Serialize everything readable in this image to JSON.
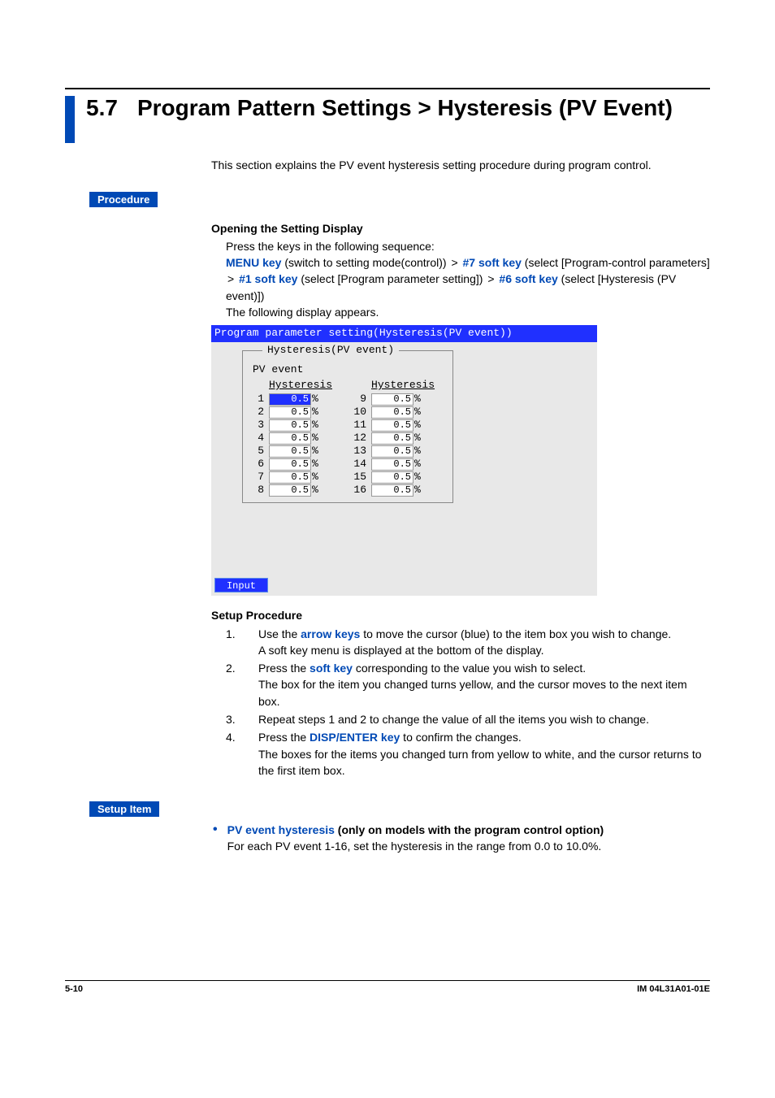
{
  "section": {
    "number": "5.7",
    "title": "Program Pattern Settings > Hysteresis (PV Event)"
  },
  "intro": "This section explains the PV event hysteresis setting procedure during program control.",
  "tags": {
    "procedure": "Procedure",
    "setup_item": "Setup Item"
  },
  "opening": {
    "head": "Opening the Setting Display",
    "press": "Press the keys in the following sequence:",
    "seq": {
      "menu_key": "MENU key",
      "menu_key_after": " (switch to setting mode(control)) ",
      "k7": "#7 soft key",
      "k7_after": " (select [Program-control parameters] ",
      "k1": "#1 soft key",
      "k1_after": " (select [Program parameter setting]) ",
      "k6": "#6 soft key",
      "k6_after": " (select [Hysteresis (PV event)])"
    },
    "appears": "The following display appears."
  },
  "screenshot": {
    "title": "Program parameter setting(Hysteresis(PV event))",
    "legend": "Hysteresis(PV event)",
    "inner_label": "PV event",
    "col_header": "Hysteresis",
    "rows_left": [
      {
        "n": "1",
        "v": "0.5",
        "sel": true
      },
      {
        "n": "2",
        "v": "0.5"
      },
      {
        "n": "3",
        "v": "0.5"
      },
      {
        "n": "4",
        "v": "0.5"
      },
      {
        "n": "5",
        "v": "0.5"
      },
      {
        "n": "6",
        "v": "0.5"
      },
      {
        "n": "7",
        "v": "0.5"
      },
      {
        "n": "8",
        "v": "0.5"
      }
    ],
    "rows_right": [
      {
        "n": "9",
        "v": "0.5"
      },
      {
        "n": "10",
        "v": "0.5"
      },
      {
        "n": "11",
        "v": "0.5"
      },
      {
        "n": "12",
        "v": "0.5"
      },
      {
        "n": "13",
        "v": "0.5"
      },
      {
        "n": "14",
        "v": "0.5"
      },
      {
        "n": "15",
        "v": "0.5"
      },
      {
        "n": "16",
        "v": "0.5"
      }
    ],
    "pct": "%",
    "soft": "Input"
  },
  "setup_proc": {
    "head": "Setup Procedure",
    "steps": [
      {
        "n": "1.",
        "pre": "Use the ",
        "key": "arrow keys",
        "post": " to move the cursor (blue) to the item box you wish to change.",
        "extra": "A soft key menu is displayed at the bottom of the display."
      },
      {
        "n": "2.",
        "pre": "Press the ",
        "key": "soft key",
        "post": " corresponding to the value you wish to select.",
        "extra": "The box for the item you changed turns yellow, and the cursor moves to the next item box."
      },
      {
        "n": "3.",
        "pre": "Repeat steps 1 and 2 to change the value of all the items you wish to change.",
        "key": "",
        "post": "",
        "extra": ""
      },
      {
        "n": "4.",
        "pre": "Press the ",
        "key": "DISP/ENTER key",
        "post": " to confirm the changes.",
        "extra": "The boxes for the items you changed turn from yellow to white, and the cursor returns to the first item box."
      }
    ]
  },
  "setup_item": {
    "bullet_key": "PV event hysteresis",
    "bullet_rest": " (only on models with the program control option)",
    "desc": "For each PV event 1-16, set the hysteresis in the range from 0.0 to 10.0%."
  },
  "footer": {
    "page": "5-10",
    "doc": "IM 04L31A01-01E"
  }
}
